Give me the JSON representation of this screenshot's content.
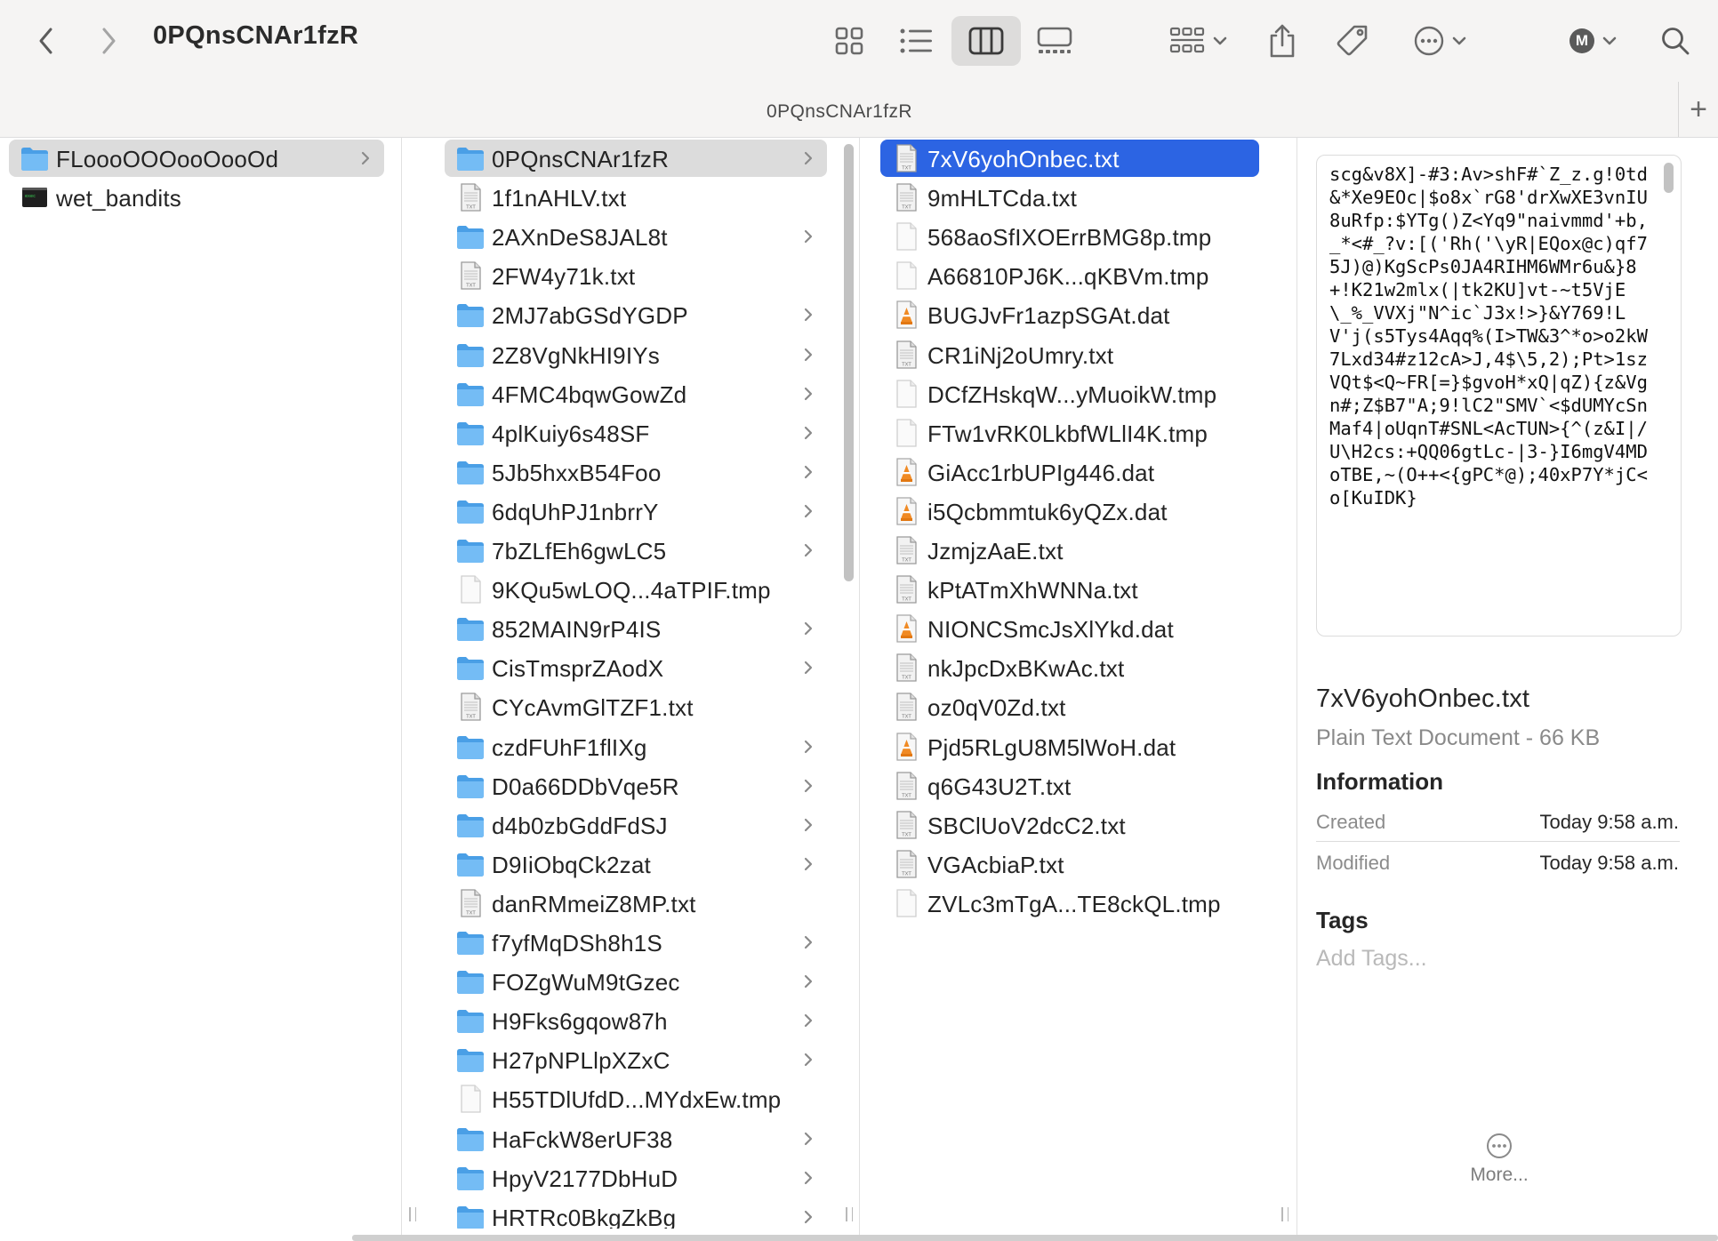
{
  "window": {
    "title": "0PQnsCNAr1fzR",
    "path_title": "0PQnsCNAr1fzR"
  },
  "toolbar": {
    "icons": [
      "chevron-left-icon",
      "chevron-right-icon",
      "icon-view-icon",
      "list-view-icon",
      "column-view-icon",
      "gallery-view-icon",
      "group-icon",
      "share-icon",
      "tag-icon",
      "more-icon",
      "user-icon",
      "search-icon"
    ],
    "active_view": "column",
    "avatar_letter": "M"
  },
  "columns": [
    {
      "items": [
        {
          "name": "FLoooOOOooOooOd",
          "kind": "folder",
          "chevron": true,
          "selected": "gray"
        },
        {
          "name": "wet_bandits",
          "kind": "exec",
          "chevron": false
        }
      ]
    },
    {
      "items": [
        {
          "name": "0PQnsCNAr1fzR",
          "kind": "folder",
          "chevron": true,
          "selected": "gray"
        },
        {
          "name": "1f1nAHLV.txt",
          "kind": "txt"
        },
        {
          "name": "2AXnDeS8JAL8t",
          "kind": "folder",
          "chevron": true
        },
        {
          "name": "2FW4y71k.txt",
          "kind": "txt"
        },
        {
          "name": "2MJ7abGSdYGDP",
          "kind": "folder",
          "chevron": true
        },
        {
          "name": "2Z8VgNkHI9IYs",
          "kind": "folder",
          "chevron": true
        },
        {
          "name": "4FMC4bqwGowZd",
          "kind": "folder",
          "chevron": true
        },
        {
          "name": "4plKuiy6s48SF",
          "kind": "folder",
          "chevron": true
        },
        {
          "name": "5Jb5hxxB54Foo",
          "kind": "folder",
          "chevron": true
        },
        {
          "name": "6dqUhPJ1nbrrY",
          "kind": "folder",
          "chevron": true
        },
        {
          "name": "7bZLfEh6gwLC5",
          "kind": "folder",
          "chevron": true
        },
        {
          "name": "9KQu5wLOQ...4aTPIF.tmp",
          "kind": "blank"
        },
        {
          "name": "852MAIN9rP4IS",
          "kind": "folder",
          "chevron": true
        },
        {
          "name": "CisTmsprZAodX",
          "kind": "folder",
          "chevron": true
        },
        {
          "name": "CYcAvmGlTZF1.txt",
          "kind": "txt"
        },
        {
          "name": "czdFUhF1flIXg",
          "kind": "folder",
          "chevron": true
        },
        {
          "name": "D0a66DDbVqe5R",
          "kind": "folder",
          "chevron": true
        },
        {
          "name": "d4b0zbGddFdSJ",
          "kind": "folder",
          "chevron": true
        },
        {
          "name": "D9IiObqCk2zat",
          "kind": "folder",
          "chevron": true
        },
        {
          "name": "danRMmeiZ8MP.txt",
          "kind": "txt"
        },
        {
          "name": "f7yfMqDSh8h1S",
          "kind": "folder",
          "chevron": true
        },
        {
          "name": "FOZgWuM9tGzec",
          "kind": "folder",
          "chevron": true
        },
        {
          "name": "H9Fks6gqow87h",
          "kind": "folder",
          "chevron": true
        },
        {
          "name": "H27pNPLlpXZxC",
          "kind": "folder",
          "chevron": true
        },
        {
          "name": "H55TDlUfdD...MYdxEw.tmp",
          "kind": "blank"
        },
        {
          "name": "HaFckW8erUF38",
          "kind": "folder",
          "chevron": true
        },
        {
          "name": "HpyV2177DbHuD",
          "kind": "folder",
          "chevron": true
        },
        {
          "name": "HRTRc0BkgZkBg",
          "kind": "folder",
          "chevron": true
        }
      ]
    },
    {
      "items": [
        {
          "name": "7xV6yohOnbec.txt",
          "kind": "txt",
          "selected": "blue"
        },
        {
          "name": "9mHLTCda.txt",
          "kind": "txt"
        },
        {
          "name": "568aoSfIXOErrBMG8p.tmp",
          "kind": "blank"
        },
        {
          "name": "A66810PJ6K...qKBVm.tmp",
          "kind": "blank"
        },
        {
          "name": "BUGJvFr1azpSGAt.dat",
          "kind": "dat"
        },
        {
          "name": "CR1iNj2oUmry.txt",
          "kind": "txt"
        },
        {
          "name": "DCfZHskqW...yMuoikW.tmp",
          "kind": "blank"
        },
        {
          "name": "FTw1vRK0LkbfWLlI4K.tmp",
          "kind": "blank"
        },
        {
          "name": "GiAcc1rbUPIg446.dat",
          "kind": "dat"
        },
        {
          "name": "i5Qcbmmtuk6yQZx.dat",
          "kind": "dat"
        },
        {
          "name": "JzmjzAaE.txt",
          "kind": "txt"
        },
        {
          "name": "kPtATmXhWNNa.txt",
          "kind": "txt"
        },
        {
          "name": "NIONCSmcJsXlYkd.dat",
          "kind": "dat"
        },
        {
          "name": "nkJpcDxBKwAc.txt",
          "kind": "txt"
        },
        {
          "name": "oz0qV0Zd.txt",
          "kind": "txt"
        },
        {
          "name": "Pjd5RLgU8M5lWoH.dat",
          "kind": "dat"
        },
        {
          "name": "q6G43U2T.txt",
          "kind": "txt"
        },
        {
          "name": "SBClUoV2dcC2.txt",
          "kind": "txt"
        },
        {
          "name": "VGAcbiaP.txt",
          "kind": "txt"
        },
        {
          "name": "ZVLc3mTgA...TE8ckQL.tmp",
          "kind": "blank"
        }
      ]
    }
  ],
  "preview": {
    "text": "scg&v8X]-#3:Av>shF#`Z_z.g!0td&*Xe9EOc|$o8x`rG8'drXwXE3vnIU8uRfp:$YTg()Z<Yq9\"naivmmd'+b,_*<#_?v:[('Rh('\\yR|EQox@c)qf75J)@)KgScPs0JA4RIHM6WMr6u&}8+!K21w2mlx(|tk2KU]vt-~t5VjE\\_%_VVXj\"N^ic`J3x!>}&Y769!LV'j(s5Tys4Aqq%(I>TW&3^*o>o2kW7Lxd34#z12cA>J,4$\\5,2);Pt>1szVQt$<Q~FR[=}$gvoH*xQ|qZ){z&Vgn#;Z$B7\"A;9!lC2\"SMV`<$dUMYcSnMaf4|oUqnT#SNL<AcTUN>{^(z&I|/U\\H2cs:+QQ06gtLc-|3-}I6mgV4MDoTBE,~(O++<{gPC*@);40xP7Y*jC<o[KuIDK}",
    "file_name": "7xV6yohOnbec.txt",
    "file_kind": "Plain Text Document - 66 KB",
    "info_heading": "Information",
    "created_label": "Created",
    "created_value": "Today 9:58 a.m.",
    "modified_label": "Modified",
    "modified_value": "Today 9:58 a.m.",
    "tags_heading": "Tags",
    "tags_placeholder": "Add Tags...",
    "more_label": "More..."
  },
  "colors": {
    "selection_blue": "#2c64e3",
    "selection_gray": "#dcdcdc",
    "folder_blue": "#5aaef0",
    "toolbar_bg": "#f5f4f3"
  }
}
